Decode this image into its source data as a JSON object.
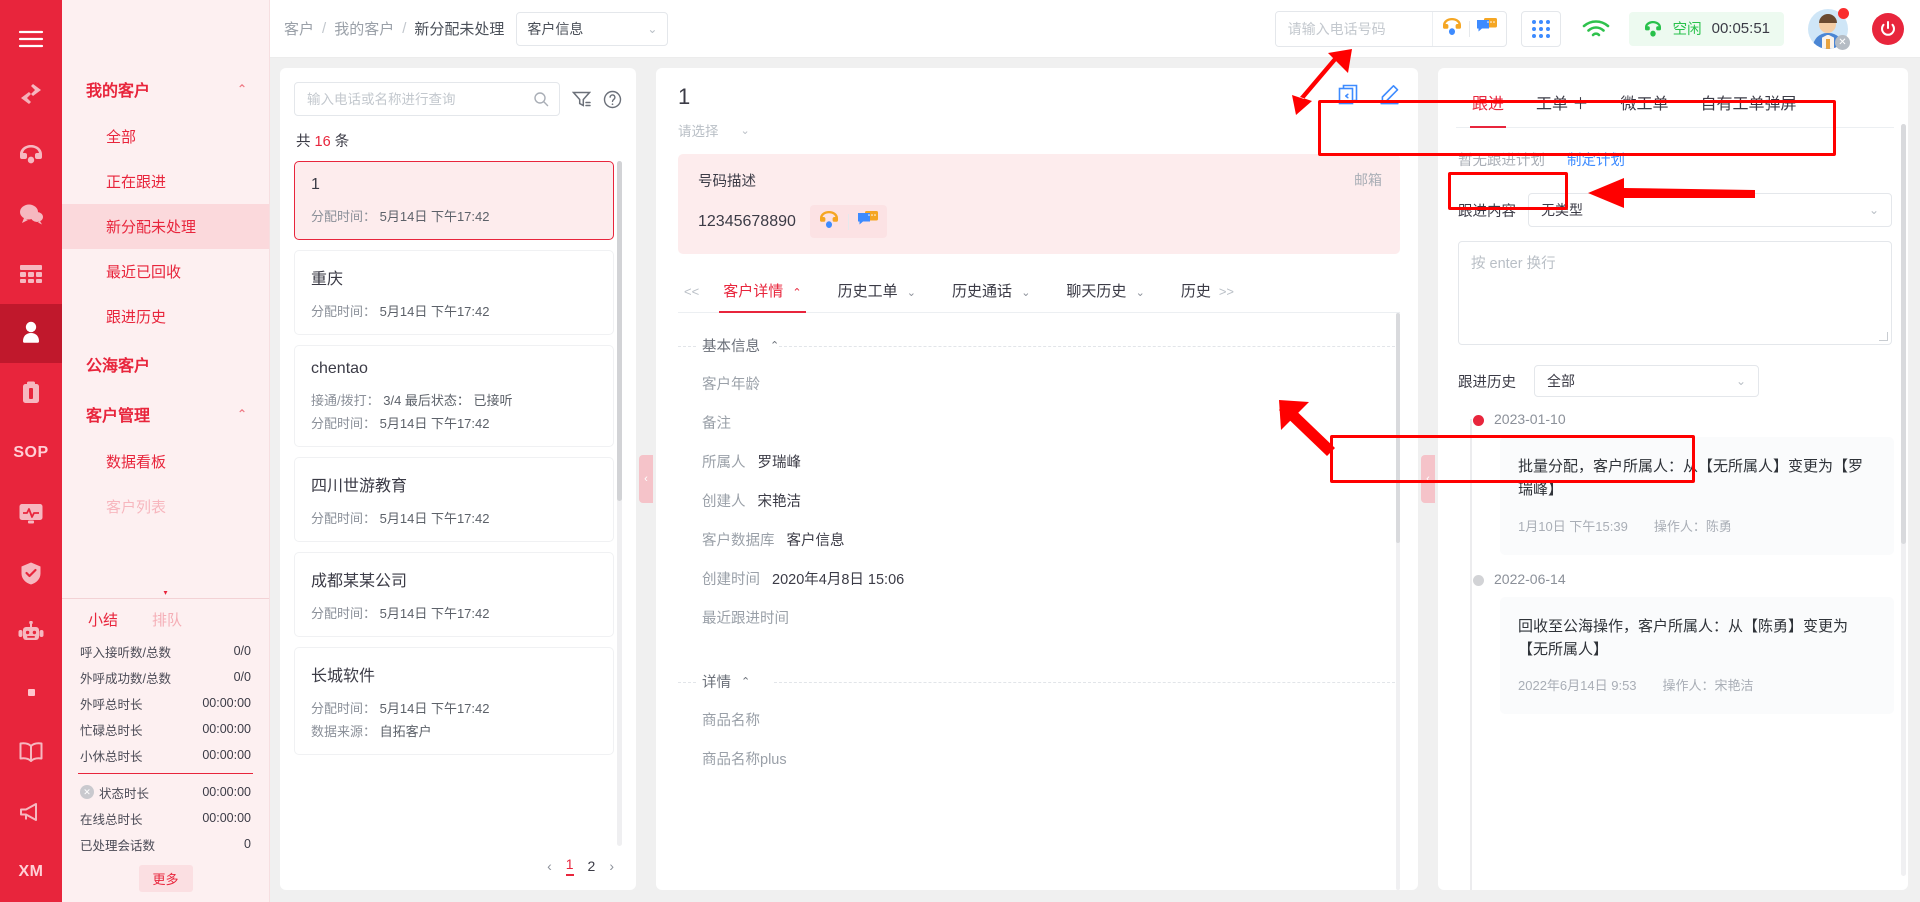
{
  "rail": {
    "items": [
      {
        "name": "hamburger-menu",
        "icon": "hamburger-icon"
      },
      {
        "name": "transfer",
        "icon": "transfer-arrows-icon"
      },
      {
        "name": "phone",
        "icon": "telephone-icon"
      },
      {
        "name": "chat",
        "icon": "chat-bubble-icon"
      },
      {
        "name": "grid",
        "icon": "grid-icon"
      },
      {
        "name": "customer",
        "icon": "person-icon"
      },
      {
        "name": "clipboard",
        "icon": "clipboard-icon"
      },
      {
        "name": "sop",
        "icon": "sop-text",
        "text": "SOP"
      },
      {
        "name": "monitor",
        "icon": "monitor-pulse-icon"
      },
      {
        "name": "shield",
        "icon": "shield-check-icon"
      },
      {
        "name": "robot",
        "icon": "robot-icon"
      },
      {
        "name": "dot",
        "icon": "dot-icon"
      },
      {
        "name": "book",
        "icon": "book-icon"
      },
      {
        "name": "megaphone",
        "icon": "megaphone-icon"
      },
      {
        "name": "xm",
        "icon": "xm-text",
        "text": "XM"
      }
    ]
  },
  "sidebar": {
    "groups": [
      {
        "label": "我的客户",
        "expanded": true,
        "items": [
          {
            "label": "全部",
            "selected": false
          },
          {
            "label": "正在跟进",
            "selected": false
          },
          {
            "label": "新分配未处理",
            "selected": true
          },
          {
            "label": "最近已回收",
            "selected": false
          },
          {
            "label": "跟进历史",
            "selected": false
          }
        ]
      },
      {
        "label": "公海客户",
        "expanded": false,
        "items": []
      },
      {
        "label": "客户管理",
        "expanded": true,
        "items": [
          {
            "label": "数据看板",
            "selected": false
          }
        ]
      }
    ],
    "stats": {
      "tabs": [
        {
          "label": "小结",
          "active": true
        },
        {
          "label": "排队",
          "active": false
        }
      ],
      "rows": [
        {
          "label": "呼入接听数/总数",
          "value": "0/0",
          "badge": false
        },
        {
          "label": "外呼成功数/总数",
          "value": "0/0",
          "badge": false
        },
        {
          "label": "外呼总时长",
          "value": "00:00:00",
          "badge": false
        },
        {
          "label": "忙碌总时长",
          "value": "00:00:00",
          "badge": false
        },
        {
          "label": "小休总时长",
          "value": "00:00:00",
          "badge": false
        }
      ],
      "rows2": [
        {
          "label": "状态时长",
          "value": "00:00:00",
          "badge": true
        },
        {
          "label": "在线总时长",
          "value": "00:00:00",
          "badge": false
        },
        {
          "label": "已处理会话数",
          "value": "0",
          "badge": false
        }
      ],
      "more_label": "更多"
    }
  },
  "topbar": {
    "breadcrumb": [
      "客户",
      "我的客户",
      "新分配未处理"
    ],
    "breadcrumb_separator": "/",
    "db_select_value": "客户信息",
    "phone_placeholder": "请输入电话号码",
    "phone_value": "",
    "status_label": "空闲",
    "timer": "00:05:51"
  },
  "list_panel": {
    "search_placeholder": "输入电话或名称进行查询",
    "search_value": "",
    "total_prefix": "共",
    "total_count": "16",
    "total_suffix": "条",
    "customers": [
      {
        "name": "1",
        "selected": true,
        "meta": [
          {
            "label": "分配时间：",
            "value": "5月14日 下午17:42"
          }
        ]
      },
      {
        "name": "重庆",
        "selected": false,
        "meta": [
          {
            "label": "分配时间：",
            "value": "5月14日 下午17:42"
          }
        ]
      },
      {
        "name": "chentao",
        "selected": false,
        "meta": [
          {
            "label": "接通/拨打：",
            "value": "3/4    最后状态： 已接听"
          },
          {
            "label": "分配时间：",
            "value": "5月14日 下午17:42"
          }
        ]
      },
      {
        "name": "四川世游教育",
        "selected": false,
        "meta": [
          {
            "label": "分配时间：",
            "value": "5月14日 下午17:42"
          }
        ]
      },
      {
        "name": "成都某某公司",
        "selected": false,
        "meta": [
          {
            "label": "分配时间：",
            "value": "5月14日 下午17:42"
          }
        ]
      },
      {
        "name": "长城软件",
        "selected": false,
        "meta": [
          {
            "label": "分配时间：",
            "value": "5月14日 下午17:42"
          },
          {
            "label": "数据来源：",
            "value": "自拓客户"
          }
        ]
      }
    ],
    "pager": {
      "prev": "‹",
      "pages": [
        "1",
        "2"
      ],
      "current": "1",
      "next": "›"
    }
  },
  "detail_panel": {
    "title": "1",
    "select_placeholder": "请选择",
    "number_box": {
      "label": "号码描述",
      "number": "12345678890",
      "right_label": "邮箱"
    },
    "tabs": {
      "prev_arrow": "<<",
      "next_arrow": ">>",
      "items": [
        {
          "label": "客户详情",
          "active": true,
          "chevron": "⌃"
        },
        {
          "label": "历史工单",
          "active": false,
          "chevron": "⌄"
        },
        {
          "label": "历史通话",
          "active": false,
          "chevron": "⌄"
        },
        {
          "label": "聊天历史",
          "active": false,
          "chevron": "⌄"
        },
        {
          "label": "历史",
          "active": false,
          "chevron": ""
        }
      ]
    },
    "sections": [
      {
        "title": "基本信息",
        "chevron": "⌃",
        "fields": [
          {
            "label": "客户年龄",
            "value": ""
          },
          {
            "label": "备注",
            "value": ""
          },
          {
            "label": "所属人",
            "value": "罗瑞峰"
          },
          {
            "label": "创建人",
            "value": "宋艳洁"
          },
          {
            "label": "客户数据库",
            "value": "客户信息"
          },
          {
            "label": "创建时间",
            "value": "2020年4月8日 15:06"
          },
          {
            "label": "最近跟进时间",
            "value": ""
          }
        ]
      },
      {
        "title": "详情",
        "chevron": "⌃",
        "fields": [
          {
            "label": "商品名称",
            "value": ""
          },
          {
            "label": "商品名称plus",
            "value": ""
          }
        ]
      }
    ]
  },
  "follow_panel": {
    "tabs": [
      {
        "label": "跟进",
        "active": true
      },
      {
        "label": "工单 ＋",
        "active": false
      },
      {
        "label": "微工单",
        "active": false
      },
      {
        "label": "自有工单弹屏",
        "active": false
      }
    ],
    "plan_none": "暂无跟进计划",
    "plan_make": "制定计划",
    "content_label": "跟进内容",
    "content_type": "无类型",
    "textarea_placeholder": "按 enter 换行",
    "history_label": "跟进历史",
    "history_filter": "全部",
    "timeline": [
      {
        "date": "2023-01-10",
        "active": true,
        "text": "批量分配，客户所属人：从【无所属人】变更为【罗瑞峰】",
        "time": "1月10日 下午15:39",
        "operator": "操作人：陈勇"
      },
      {
        "date": "2022-06-14",
        "active": false,
        "text": "回收至公海操作，客户所属人：从【陈勇】变更为【无所属人】",
        "time": "2022年6月14日 9:53",
        "operator": "操作人：宋艳洁"
      }
    ]
  },
  "colors": {
    "brand": "#e8253c",
    "sidebar_bg": "#fdf0f1",
    "accent_blue": "#3d8bff",
    "status_green": "#28c14b",
    "annotation": "#ff0000"
  }
}
